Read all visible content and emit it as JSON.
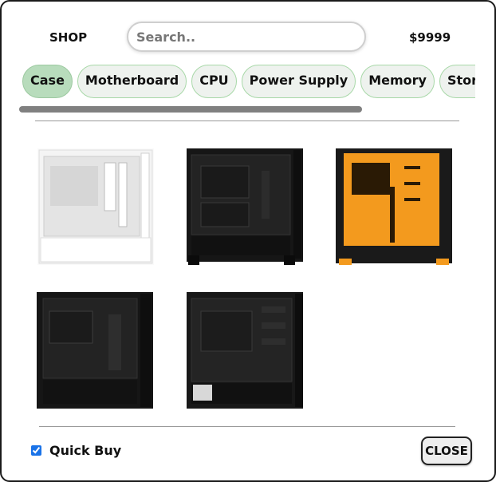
{
  "header": {
    "shop_label": "SHOP",
    "search_placeholder": "Search..",
    "balance": "$9999"
  },
  "categories": [
    {
      "label": "Case",
      "active": true
    },
    {
      "label": "Motherboard",
      "active": false
    },
    {
      "label": "CPU",
      "active": false
    },
    {
      "label": "Power Supply",
      "active": false
    },
    {
      "label": "Memory",
      "active": false
    },
    {
      "label": "Storage",
      "active": false
    }
  ],
  "products": [
    {
      "name": "case-white",
      "color": "#f2f2f2",
      "accent": "#ffffff"
    },
    {
      "name": "case-black",
      "color": "#1b1b1b",
      "accent": "#2a2a2a"
    },
    {
      "name": "case-orange",
      "color": "#f39a1e",
      "accent": "#1b1b1b"
    },
    {
      "name": "case-black-2",
      "color": "#1a1a1a",
      "accent": "#2a2a2a"
    },
    {
      "name": "case-black-3",
      "color": "#1c1c1c",
      "accent": "#2c2c2c"
    }
  ],
  "footer": {
    "quick_buy_label": "Quick Buy",
    "quick_buy_checked": true,
    "close_label": "CLOSE"
  }
}
